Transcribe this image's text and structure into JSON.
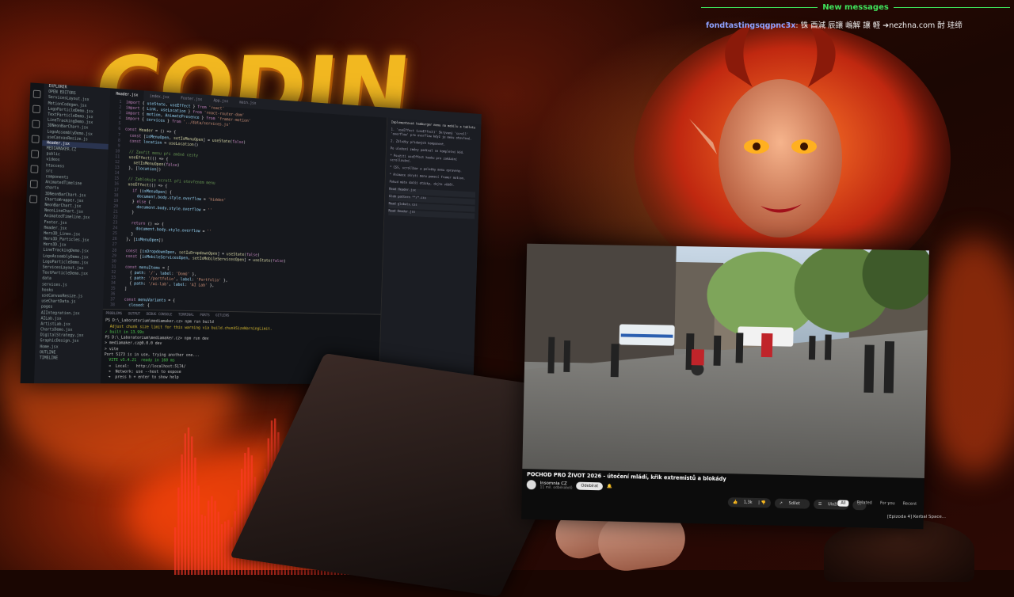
{
  "overlay_logo": "CODIN",
  "chat": {
    "header": "New messages",
    "messages": [
      {
        "user": "fondtastingsqgpnc3x",
        "text": ": 铢 酉減 辰讓 嶋解 讓 軽 ➔nezhna.com 酎 珪缔"
      }
    ]
  },
  "editor": {
    "explorer_label": "EXPLORER",
    "files": [
      "OPEN EDITORS",
      "ServicesLayout.jsx",
      "MotionCodegen.jsx",
      "LogoParticleDemo.jsx",
      "TextParticleDemo.jsx",
      "LineTrackingDemo.jsx",
      "3DNeonBarChart.jsx",
      "LogoAssemblyDemo.jsx",
      "useCanvasResize.js",
      "Header.jsx",
      "MEDIAMAKER.CZ",
      "public",
      "videos",
      "htaccess",
      "src",
      "components",
      "AnimatedTimeline",
      "charts",
      "3DNeonBarChart.jsx",
      "ChartsWrapper.jsx",
      "NeonBarChart.jsx",
      "NeonLineChart.jsx",
      "AnimatedTimeline.jsx",
      "Footer.jsx",
      "Header.jsx",
      "Hero3D_Lines.jsx",
      "Hero3D_Particles.jsx",
      "Hero3D.jsx",
      "LineTrackingDemo.jsx",
      "LogoAssemblyDemo.jsx",
      "LogoParticleDemo.jsx",
      "ServicesLayout.jsx",
      "TextParticleDemo.jsx",
      "data",
      "services.js",
      "hooks",
      "useCanvasResize.js",
      "useChartData.js",
      "pages",
      "AIIntegration.jsx",
      "AILab.jsx",
      "ArtistLab.jsx",
      "ChartsDemo.jsx",
      "DigitalStrategy.jsx",
      "GraphicDesign.jsx",
      "Home.jsx",
      "OUTLINE",
      "TIMELINE"
    ],
    "active_file": "Header.jsx",
    "tabs": [
      "Header.jsx",
      "index.jsx",
      "Footer.jsx",
      "App.jsx",
      "main.jsx"
    ],
    "active_tab": "Header.jsx",
    "terminal_tabs": "PROBLEMS   OUTPUT   DEBUG CONSOLE   TERMINAL   PORTS   GITLENS",
    "terminal_lines": [
      "PS D:\\_Laboratorium\\mediamaker.cz> npm run build",
      "  Adjust chunk size limit for this warning via build.chunkSizeWarningLimit.",
      "✓ built in 13.99s",
      "PS D:\\_Laboratorium\\mediamaker.cz> npm run dev",
      "",
      "> mediamaker.cz@0.0.0 dev",
      "> vite",
      "",
      "Port 5173 is in use, trying another one...",
      "",
      "  VITE v5.4.21  ready in 160 ms",
      "",
      "  ➜  Local:   http://localhost:5174/",
      "  ➜  Network: use --host to expose",
      "  ➜  press h + enter to show help"
    ],
    "chat_panel_title": "Implementovat hamburger menu na mobilu a tabletu",
    "chat_panel_lines": [
      "1. 'useEffect (useEffect)' Skrývaný 'scroll' 'overflow' pro overflow když je menu otevřené.",
      "2. Záložky přidaných komponent.",
      "Po uložení změny podíval se kompletní kód.",
      "* Použití useEffect hooku pro zakázání scrollování.",
      "* CSS, scrollbar a položky menu opraveny.",
      "* Animace skrytí menu pomocí framer motion.",
      "Pokud máte další otázky, dejte vědět."
    ],
    "chat_panel_items": [
      "Read Header.jsx",
      "Glob pattern **/*.css",
      "Read globals.css",
      "Read Header.jsx"
    ]
  },
  "video": {
    "title": "POCHOD PRO ŽIVOT 2026 - útočení mládí, křik extremistů a blokády",
    "channel": "Insomnia CZ",
    "channel_sub": "11 mil. odběratelů",
    "subscribe_label": "Odebírat",
    "likes": "1,3k",
    "share_label": "Sdílet",
    "save_label": "Uložit",
    "right_tabs": [
      "All",
      "Related",
      "For you",
      "Recent"
    ],
    "side_item": "[Epizoda 4] Kerbal Space..."
  }
}
